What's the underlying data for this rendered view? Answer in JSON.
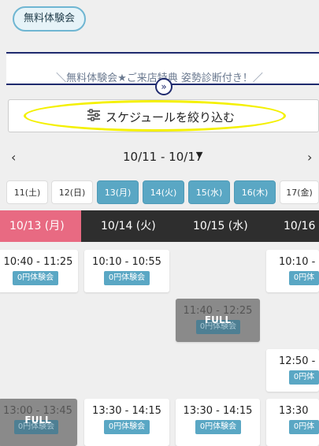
{
  "tag": "無料体験会",
  "promo": "＼無料体験会★ご来店特典 姿勢診断付き！／",
  "filter": {
    "label": "スケジュールを絞り込む"
  },
  "week": {
    "range": "10/11 - 10/17",
    "prev": "‹",
    "next": "›",
    "arrow": "▼"
  },
  "days": [
    "11(土)",
    "12(日)",
    "13(月)",
    "14(火)",
    "15(水)",
    "16(木)",
    "17(金)"
  ],
  "headers": [
    "10/13 (月)",
    "10/14 (火)",
    "10/15 (水)",
    "10/16 ("
  ],
  "slots": {
    "s1": {
      "time": "10:40 - 11:25",
      "badge": "0円体験会"
    },
    "s2": {
      "time": "10:10 - 10:55",
      "badge": "0円体験会"
    },
    "s3": {
      "time": "10:10 - ",
      "badge": "0円体"
    },
    "s4": {
      "time": "11:40 - 12:25",
      "badge": "0円体験会",
      "status": "FULL"
    },
    "s5": {
      "time": "12:50 - ",
      "badge": "0円体"
    },
    "s6": {
      "time": "13:00 - 13:45",
      "badge": "0円体験会",
      "status": "FULL"
    },
    "s7": {
      "time": "13:30 - 14:15",
      "badge": "0円体験会"
    },
    "s8": {
      "time": "13:30 - 14:15",
      "badge": "0円体験会"
    },
    "s9": {
      "time": "13:30",
      "badge": "0円体"
    }
  }
}
